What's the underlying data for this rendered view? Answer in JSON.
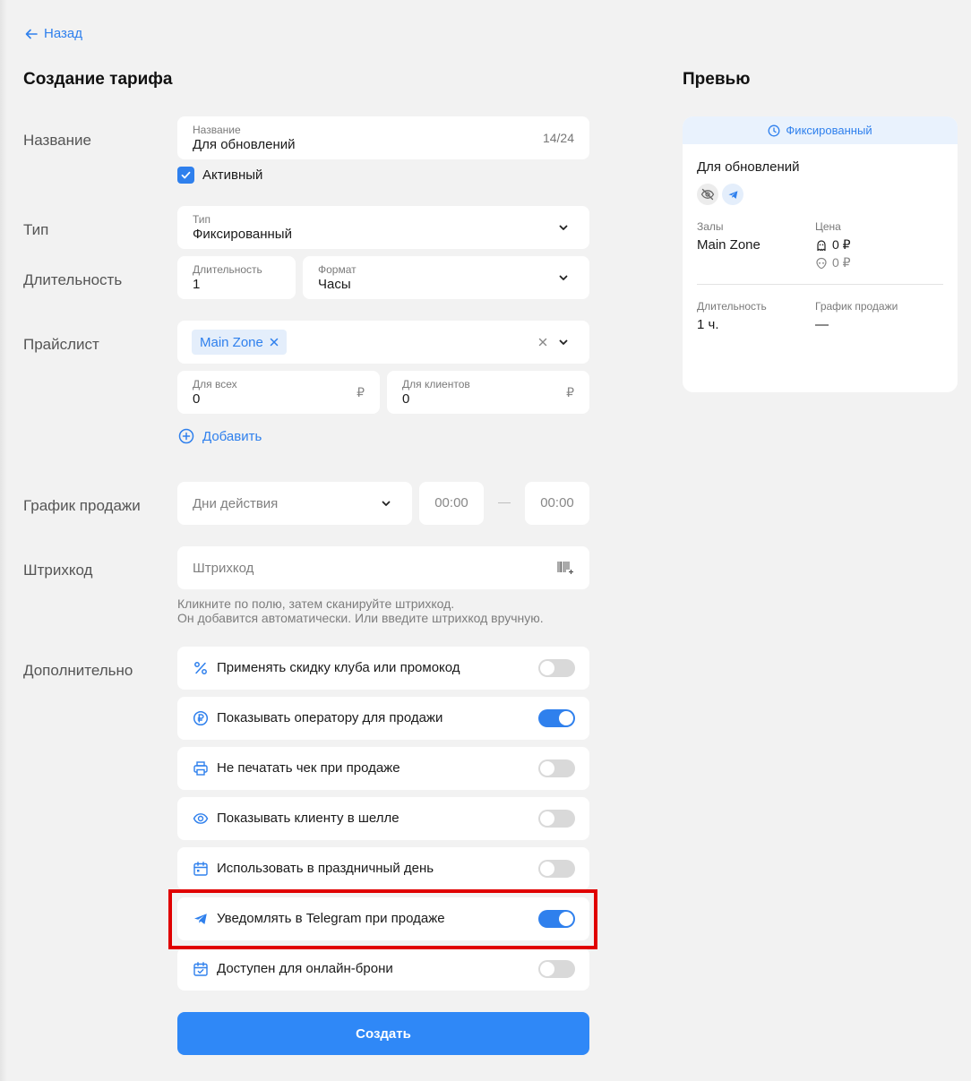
{
  "nav": {
    "back_label": "Назад"
  },
  "page": {
    "title": "Создание тарифа",
    "preview_title": "Превью"
  },
  "form": {
    "name": {
      "row_label": "Название",
      "label": "Название",
      "value": "Для обновлений",
      "counter": "14/24"
    },
    "active": {
      "label": "Активный",
      "checked": true
    },
    "type": {
      "row_label": "Тип",
      "label": "Тип",
      "value": "Фиксированный"
    },
    "duration": {
      "row_label": "Длительность",
      "label": "Длительность",
      "value": "1"
    },
    "format": {
      "label": "Формат",
      "value": "Часы"
    },
    "pricelist": {
      "row_label": "Прайслист",
      "chip": "Main Zone",
      "for_all_label": "Для всех",
      "for_all_value": "0",
      "for_clients_label": "Для клиентов",
      "for_clients_value": "0",
      "currency": "₽",
      "add_label": "Добавить"
    },
    "schedule": {
      "row_label": "График продажи",
      "days_placeholder": "Дни действия",
      "time_from": "00:00",
      "separator": "—",
      "time_to": "00:00"
    },
    "barcode": {
      "row_label": "Штрихкод",
      "placeholder": "Штрихкод",
      "hint_line1": "Кликните по полю, затем сканируйте штрихкод.",
      "hint_line2": "Он добавится автоматически. Или введите штрихкод вручную."
    },
    "extra": {
      "row_label": "Дополнительно",
      "options": [
        {
          "label": "Применять скидку клуба или промокод",
          "icon": "percent-icon",
          "on": false
        },
        {
          "label": "Показывать оператору для продажи",
          "icon": "ruble-coin-icon",
          "on": true
        },
        {
          "label": "Не печатать чек при продаже",
          "icon": "printer-icon",
          "on": false
        },
        {
          "label": "Показывать клиенту в шелле",
          "icon": "eye-icon",
          "on": false
        },
        {
          "label": "Использовать в праздничный день",
          "icon": "calendar-icon",
          "on": false
        },
        {
          "label": "Уведомлять в Telegram при продаже",
          "icon": "telegram-icon",
          "on": true
        },
        {
          "label": "Доступен для онлайн-брони",
          "icon": "calendar-check-icon",
          "on": false
        }
      ]
    },
    "submit_label": "Создать"
  },
  "preview": {
    "type_badge": "Фиксированный",
    "name": "Для обновлений",
    "halls_label": "Залы",
    "halls_value": "Main Zone",
    "price_label": "Цена",
    "price_1": "0 ₽",
    "price_2": "0 ₽",
    "duration_label": "Длительность",
    "duration_value": "1 ч.",
    "schedule_label": "График продажи",
    "schedule_value": "—"
  },
  "colors": {
    "accent": "#2f80ed",
    "button": "#2f88f7",
    "highlight": "#e00000",
    "background": "#f2f2f2"
  }
}
